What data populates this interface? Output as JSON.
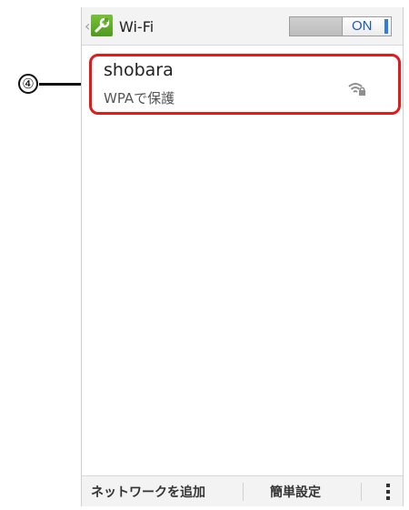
{
  "header": {
    "title": "Wi-Fi",
    "toggle_label": "ON"
  },
  "network": {
    "ssid": "shobara",
    "security": "WPAで保護"
  },
  "annotation": {
    "callout": "④"
  },
  "bottom_bar": {
    "add_network_label": "ネットワークを追加",
    "easy_setup_label": "簡単設定"
  },
  "colors": {
    "accent": "#2f7de0",
    "highlight": "#e11b1b",
    "icon_green": "#5ba52a"
  },
  "icons": [
    "back-chevron-icon",
    "wrench-icon",
    "wifi-lock-icon",
    "overflow-menu-icon"
  ]
}
